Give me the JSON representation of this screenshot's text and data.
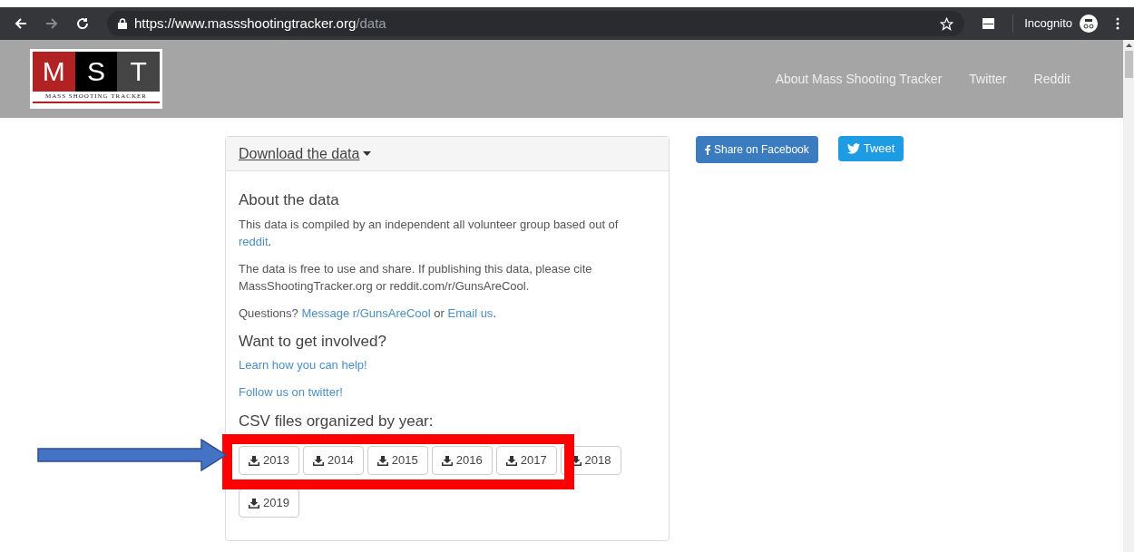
{
  "browser": {
    "url_host": "https://www.massshootingtracker.org",
    "url_path": "/data",
    "profile": "Incognito"
  },
  "header": {
    "logo": {
      "letters": [
        "M",
        "S",
        "T"
      ],
      "tagline": "MASS SHOOTING TRACKER"
    },
    "nav": [
      "About Mass Shooting Tracker",
      "Twitter",
      "Reddit"
    ]
  },
  "panel": {
    "heading": "Download the data",
    "sections": [
      {
        "kind": "title",
        "text": "About the data"
      },
      {
        "kind": "paragraph",
        "parts": [
          {
            "text": "This data is compiled by an independent all volunteer group based out of ",
            "link": false
          },
          {
            "text": "reddit",
            "link": true
          },
          {
            "text": ".",
            "link": false
          }
        ]
      },
      {
        "kind": "paragraph",
        "parts": [
          {
            "text": "The data is free to use and share. If publishing this data, please cite MassShootingTracker.org or reddit.com/r/GunsAreCool.",
            "link": false
          }
        ]
      },
      {
        "kind": "paragraph",
        "parts": [
          {
            "text": "Questions? ",
            "link": false
          },
          {
            "text": "Message r/GunsAreCool",
            "link": true
          },
          {
            "text": " or ",
            "link": false
          },
          {
            "text": "Email us",
            "link": true
          },
          {
            "text": ".",
            "link": false
          }
        ]
      },
      {
        "kind": "title",
        "text": "Want to get involved?"
      },
      {
        "kind": "link",
        "text": "Learn how you can help!"
      },
      {
        "kind": "link",
        "text": "Follow us on twitter!"
      },
      {
        "kind": "title",
        "text": "CSV files organized by year:"
      }
    ],
    "years": [
      "2013",
      "2014",
      "2015",
      "2016",
      "2017",
      "2018",
      "2019"
    ]
  },
  "social": [
    {
      "kind": "facebook",
      "label": "Share on Facebook"
    },
    {
      "kind": "twitter",
      "label": "Tweet"
    }
  ]
}
